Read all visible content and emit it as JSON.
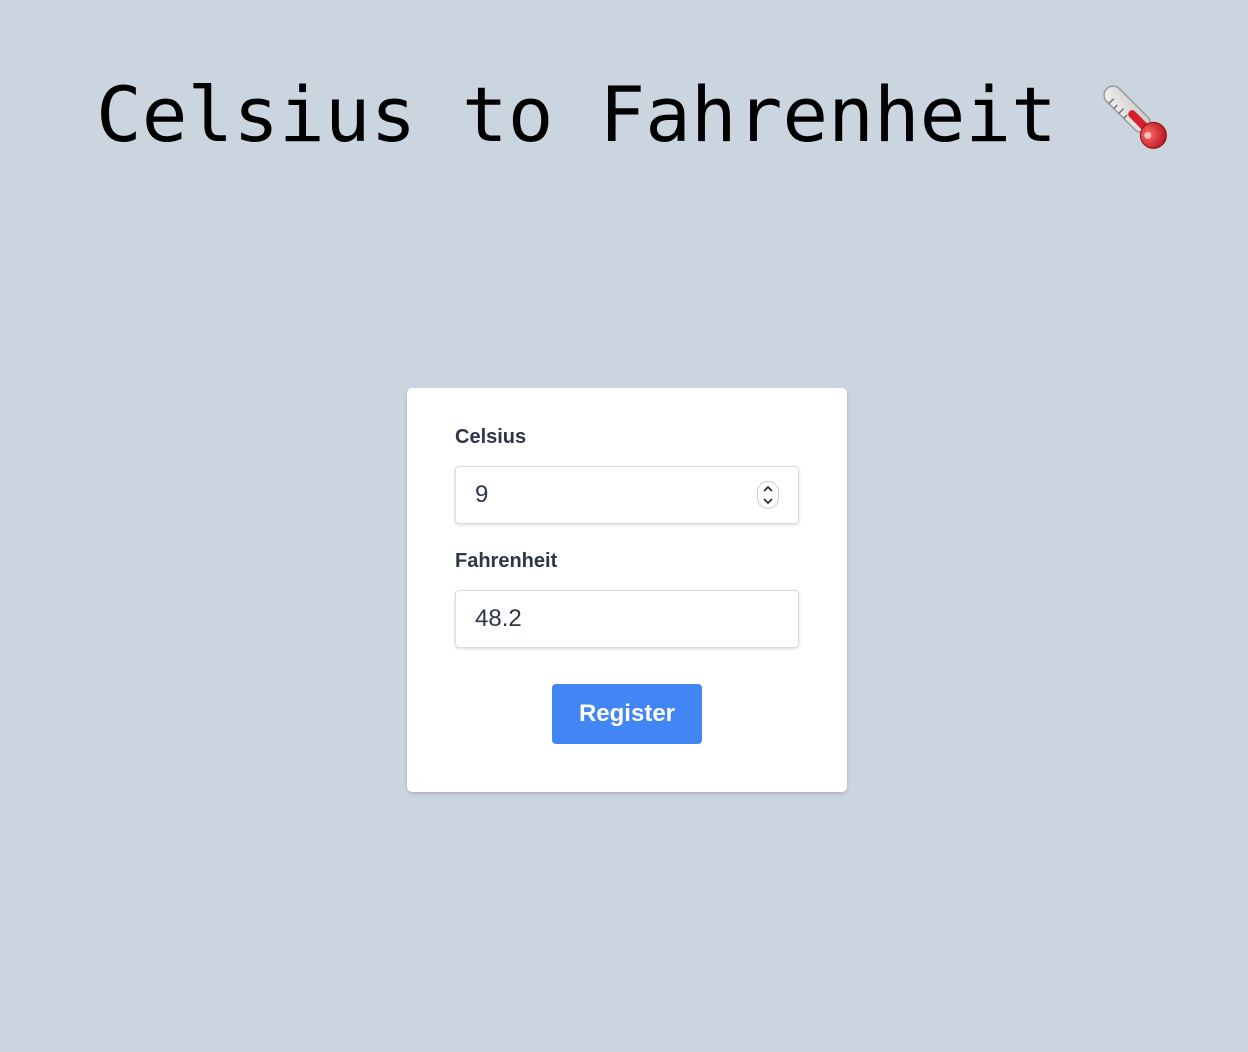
{
  "header": {
    "title": "Celsius to Fahrenheit",
    "icon": "thermometer-icon"
  },
  "form": {
    "celsius_label": "Celsius",
    "celsius_value": "9",
    "fahrenheit_label": "Fahrenheit",
    "fahrenheit_value": "48.2",
    "submit_label": "Register"
  },
  "colors": {
    "background": "#cbd5e0",
    "card": "#ffffff",
    "button": "#4285f4",
    "label": "#2d3748"
  }
}
